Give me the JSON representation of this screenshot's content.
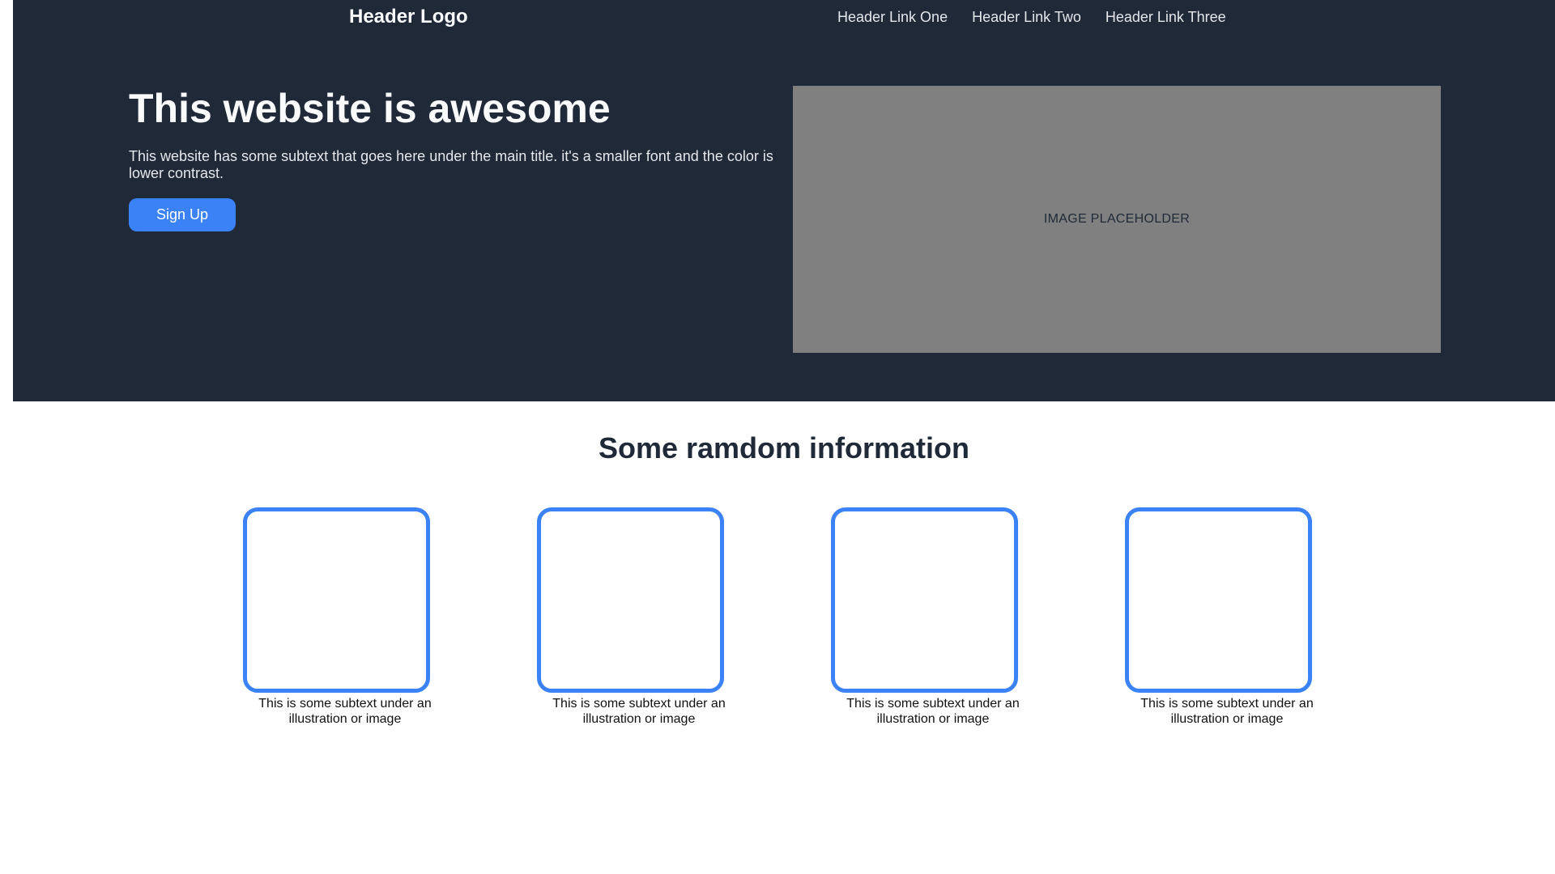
{
  "header": {
    "logo": "Header Logo",
    "links": [
      "Header Link One",
      "Header Link Two",
      "Header Link Three"
    ]
  },
  "hero": {
    "title": "This website is awesome",
    "subtitle": "This website has some subtext that goes here under the main title. it's a smaller font and the color is lower contrast.",
    "button_label": "Sign Up",
    "image_placeholder": "IMAGE PLACEHOLDER"
  },
  "info": {
    "title": "Some ramdom information",
    "items": [
      {
        "caption": "This is some subtext under an illustration or image"
      },
      {
        "caption": "This is some subtext under an illustration or image"
      },
      {
        "caption": "This is some subtext under an illustration or image"
      },
      {
        "caption": "This is some subtext under an illustration or image"
      }
    ]
  },
  "colors": {
    "header_bg": "#1f2937",
    "accent": "#3b82f6",
    "placeholder_bg": "#808080"
  }
}
